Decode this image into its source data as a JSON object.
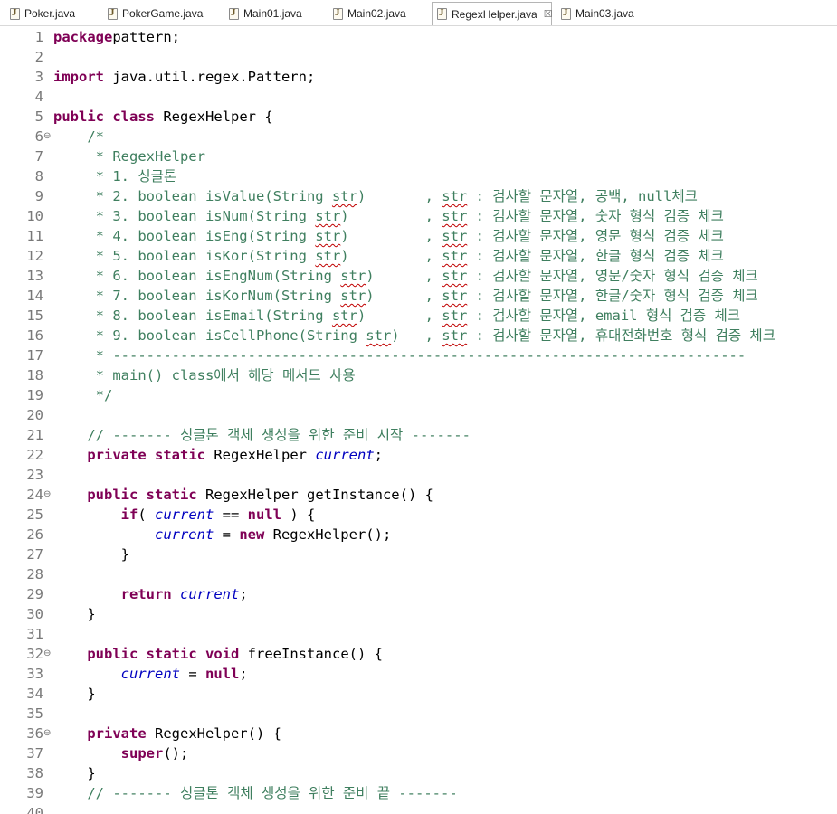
{
  "tabs": [
    {
      "label": "Poker.java",
      "active": false
    },
    {
      "label": "PokerGame.java",
      "active": false
    },
    {
      "label": "Main01.java",
      "active": false
    },
    {
      "label": "Main02.java",
      "active": false
    },
    {
      "label": "RegexHelper.java",
      "active": true,
      "close_icon": "close-icon"
    },
    {
      "label": "Main03.java",
      "active": false
    }
  ],
  "colors": {
    "keyword": "#7f0055",
    "comment": "#3f7f5f",
    "field": "#0000c0",
    "line_number": "#787878",
    "squiggle": "#c00000"
  },
  "lines": [
    {
      "n": "1",
      "fold": "",
      "seg": [
        [
          "kw",
          "package"
        ],
        [
          "",
          "pattern;"
        ]
      ]
    },
    {
      "n": "2",
      "fold": "",
      "seg": []
    },
    {
      "n": "3",
      "fold": "",
      "seg": [
        [
          "kw",
          "import"
        ],
        [
          "",
          " java.util.regex.Pattern;"
        ]
      ]
    },
    {
      "n": "4",
      "fold": "",
      "seg": []
    },
    {
      "n": "5",
      "fold": "",
      "seg": [
        [
          "kw",
          "public"
        ],
        [
          "",
          " "
        ],
        [
          "kw",
          "class"
        ],
        [
          "",
          " RegexHelper {"
        ]
      ]
    },
    {
      "n": "6",
      "fold": "⊖",
      "seg": [
        [
          "cm",
          "    /*"
        ]
      ]
    },
    {
      "n": "7",
      "fold": "",
      "seg": [
        [
          "cm",
          "     * RegexHelper"
        ]
      ]
    },
    {
      "n": "8",
      "fold": "",
      "seg": [
        [
          "cm",
          "     * 1. 싱글톤"
        ]
      ]
    },
    {
      "n": "9",
      "fold": "",
      "seg": [
        [
          "cm",
          "     * 2. boolean isValue(String "
        ],
        [
          "cmsq",
          "str"
        ],
        [
          "cm",
          ")       , "
        ],
        [
          "cmsq",
          "str"
        ],
        [
          "cm",
          " : 검사할 문자열, 공백, null체크"
        ]
      ]
    },
    {
      "n": "10",
      "fold": "",
      "seg": [
        [
          "cm",
          "     * 3. boolean isNum(String "
        ],
        [
          "cmsq",
          "str"
        ],
        [
          "cm",
          ")         , "
        ],
        [
          "cmsq",
          "str"
        ],
        [
          "cm",
          " : 검사할 문자열, 숫자 형식 검증 체크"
        ]
      ]
    },
    {
      "n": "11",
      "fold": "",
      "seg": [
        [
          "cm",
          "     * 4. boolean isEng(String "
        ],
        [
          "cmsq",
          "str"
        ],
        [
          "cm",
          ")         , "
        ],
        [
          "cmsq",
          "str"
        ],
        [
          "cm",
          " : 검사할 문자열, 영문 형식 검증 체크"
        ]
      ]
    },
    {
      "n": "12",
      "fold": "",
      "seg": [
        [
          "cm",
          "     * 5. boolean isKor(String "
        ],
        [
          "cmsq",
          "str"
        ],
        [
          "cm",
          ")         , "
        ],
        [
          "cmsq",
          "str"
        ],
        [
          "cm",
          " : 검사할 문자열, 한글 형식 검증 체크"
        ]
      ]
    },
    {
      "n": "13",
      "fold": "",
      "seg": [
        [
          "cm",
          "     * 6. boolean isEngNum(String "
        ],
        [
          "cmsq",
          "str"
        ],
        [
          "cm",
          ")      , "
        ],
        [
          "cmsq",
          "str"
        ],
        [
          "cm",
          " : 검사할 문자열, 영문/숫자 형식 검증 체크"
        ]
      ]
    },
    {
      "n": "14",
      "fold": "",
      "seg": [
        [
          "cm",
          "     * 7. boolean isKorNum(String "
        ],
        [
          "cmsq",
          "str"
        ],
        [
          "cm",
          ")      , "
        ],
        [
          "cmsq",
          "str"
        ],
        [
          "cm",
          " : 검사할 문자열, 한글/숫자 형식 검증 체크"
        ]
      ]
    },
    {
      "n": "15",
      "fold": "",
      "seg": [
        [
          "cm",
          "     * 8. boolean isEmail(String "
        ],
        [
          "cmsq",
          "str"
        ],
        [
          "cm",
          ")       , "
        ],
        [
          "cmsq",
          "str"
        ],
        [
          "cm",
          " : 검사할 문자열, email 형식 검증 체크"
        ]
      ]
    },
    {
      "n": "16",
      "fold": "",
      "seg": [
        [
          "cm",
          "     * 9. boolean isCellPhone(String "
        ],
        [
          "cmsq",
          "str"
        ],
        [
          "cm",
          ")   , "
        ],
        [
          "cmsq",
          "str"
        ],
        [
          "cm",
          " : 검사할 문자열, 휴대전화번호 형식 검증 체크"
        ]
      ]
    },
    {
      "n": "17",
      "fold": "",
      "seg": [
        [
          "cm",
          "     * ---------------------------------------------------------------------------"
        ]
      ]
    },
    {
      "n": "18",
      "fold": "",
      "seg": [
        [
          "cm",
          "     * main() class에서 해당 메서드 사용"
        ]
      ]
    },
    {
      "n": "19",
      "fold": "",
      "seg": [
        [
          "cm",
          "     */"
        ]
      ]
    },
    {
      "n": "20",
      "fold": "",
      "seg": []
    },
    {
      "n": "21",
      "fold": "",
      "seg": [
        [
          "cm",
          "    // ------- 싱글톤 객체 생성을 위한 준비 시작 -------"
        ]
      ]
    },
    {
      "n": "22",
      "fold": "",
      "seg": [
        [
          "",
          "    "
        ],
        [
          "kw",
          "private"
        ],
        [
          "",
          " "
        ],
        [
          "kw",
          "static"
        ],
        [
          "",
          " RegexHelper "
        ],
        [
          "fld",
          "current"
        ],
        [
          "",
          ";"
        ]
      ]
    },
    {
      "n": "23",
      "fold": "",
      "seg": []
    },
    {
      "n": "24",
      "fold": "⊖",
      "seg": [
        [
          "",
          "    "
        ],
        [
          "kw",
          "public"
        ],
        [
          "",
          " "
        ],
        [
          "kw",
          "static"
        ],
        [
          "",
          " RegexHelper getInstance() {"
        ]
      ]
    },
    {
      "n": "25",
      "fold": "",
      "seg": [
        [
          "",
          "        "
        ],
        [
          "kw",
          "if"
        ],
        [
          "",
          "( "
        ],
        [
          "fld",
          "current"
        ],
        [
          "",
          " == "
        ],
        [
          "kw",
          "null"
        ],
        [
          "",
          " ) {"
        ]
      ]
    },
    {
      "n": "26",
      "fold": "",
      "seg": [
        [
          "",
          "            "
        ],
        [
          "fld",
          "current"
        ],
        [
          "",
          " = "
        ],
        [
          "kw",
          "new"
        ],
        [
          "",
          " RegexHelper();"
        ]
      ]
    },
    {
      "n": "27",
      "fold": "",
      "seg": [
        [
          "",
          "        }"
        ]
      ]
    },
    {
      "n": "28",
      "fold": "",
      "seg": []
    },
    {
      "n": "29",
      "fold": "",
      "seg": [
        [
          "",
          "        "
        ],
        [
          "kw",
          "return"
        ],
        [
          "",
          " "
        ],
        [
          "fld",
          "current"
        ],
        [
          "",
          ";"
        ]
      ]
    },
    {
      "n": "30",
      "fold": "",
      "seg": [
        [
          "",
          "    }"
        ]
      ]
    },
    {
      "n": "31",
      "fold": "",
      "seg": []
    },
    {
      "n": "32",
      "fold": "⊖",
      "seg": [
        [
          "",
          "    "
        ],
        [
          "kw",
          "public"
        ],
        [
          "",
          " "
        ],
        [
          "kw",
          "static"
        ],
        [
          "",
          " "
        ],
        [
          "kw",
          "void"
        ],
        [
          "",
          " freeInstance() {"
        ]
      ]
    },
    {
      "n": "33",
      "fold": "",
      "seg": [
        [
          "",
          "        "
        ],
        [
          "fld",
          "current"
        ],
        [
          "",
          " = "
        ],
        [
          "kw",
          "null"
        ],
        [
          "",
          ";"
        ]
      ]
    },
    {
      "n": "34",
      "fold": "",
      "seg": [
        [
          "",
          "    }"
        ]
      ]
    },
    {
      "n": "35",
      "fold": "",
      "seg": []
    },
    {
      "n": "36",
      "fold": "⊖",
      "seg": [
        [
          "",
          "    "
        ],
        [
          "kw",
          "private"
        ],
        [
          "",
          " RegexHelper() {"
        ]
      ]
    },
    {
      "n": "37",
      "fold": "",
      "seg": [
        [
          "",
          "        "
        ],
        [
          "kw",
          "super"
        ],
        [
          "",
          "();"
        ]
      ]
    },
    {
      "n": "38",
      "fold": "",
      "seg": [
        [
          "",
          "    }"
        ]
      ]
    },
    {
      "n": "39",
      "fold": "",
      "seg": [
        [
          "cm",
          "    // ------- 싱글톤 객체 생성을 위한 준비 끝 -------"
        ]
      ]
    },
    {
      "n": "40",
      "fold": "",
      "seg": []
    }
  ]
}
